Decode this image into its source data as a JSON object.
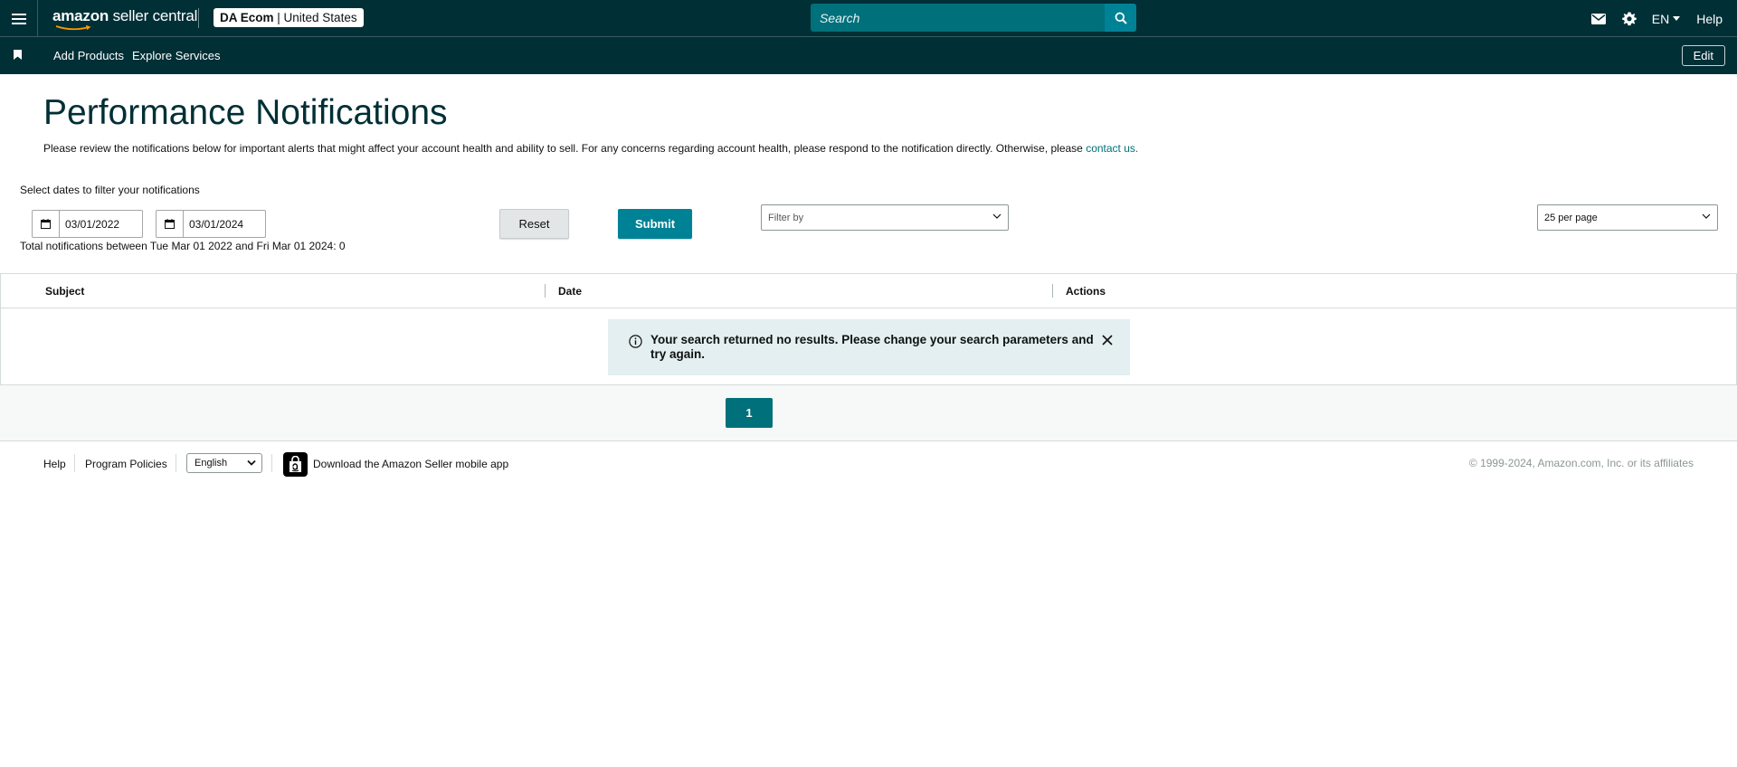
{
  "header": {
    "logo_brand": "amazon",
    "logo_product": " seller central",
    "account_name": "DA Ecom",
    "account_sep": " | ",
    "account_region": "United States",
    "search_placeholder": "Search",
    "lang": "EN",
    "help": "Help",
    "icons": [
      "menu-icon",
      "search-icon",
      "mail-icon",
      "gear-icon",
      "caret-down-icon"
    ]
  },
  "nav": {
    "add_products": "Add Products",
    "explore_services": "Explore Services",
    "edit": "Edit"
  },
  "page": {
    "title": "Performance Notifications",
    "intro": "Please review the notifications below for important alerts that might affect your account health and ability to sell. For any concerns regarding account health, please respond to the notification directly. Otherwise, please ",
    "intro_link": "contact us.",
    "date_caption": "Select dates to filter your notifications",
    "start_date": "03/01/2022",
    "end_date": "03/01/2024",
    "reset": "Reset",
    "submit": "Submit",
    "filter_placeholder": "Filter by",
    "per_page": "25 per page",
    "total_line": "Total notifications between Tue Mar 01 2022 and Fri Mar 01 2024: 0"
  },
  "table": {
    "columns": [
      "Subject",
      "Date",
      "Actions"
    ],
    "empty_message": "Your search returned no results. Please change your search parameters and try again."
  },
  "pagination": {
    "current_page": "1"
  },
  "footer": {
    "help": "Help",
    "program_policies": "Program Policies",
    "language": "English",
    "app_download": "Download the Amazon Seller mobile app",
    "copyright": "© 1999-2024, Amazon.com, Inc. or its affiliates"
  },
  "colors": {
    "header_bg": "#002f36",
    "accent": "#008296",
    "alert_bg": "#e3eff0"
  }
}
